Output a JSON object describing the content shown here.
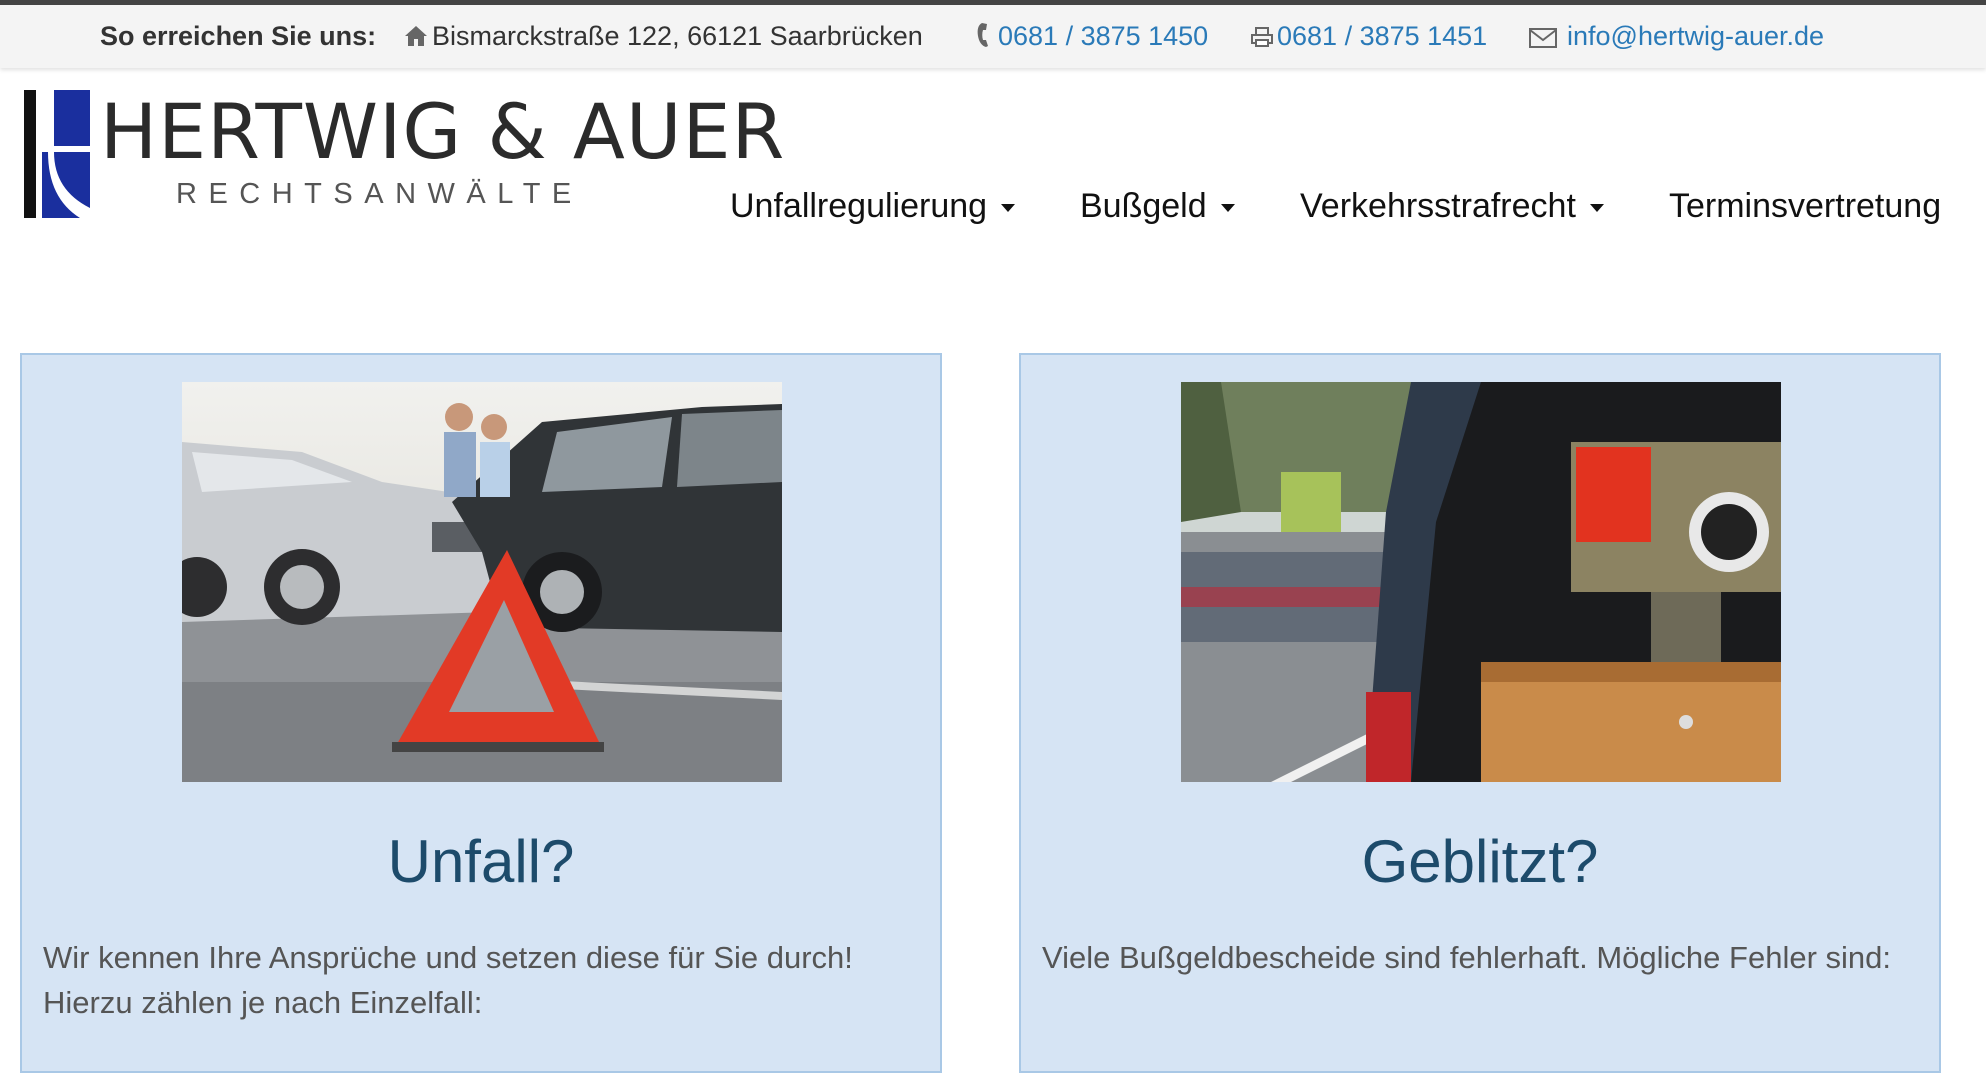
{
  "topbar": {
    "label": "So erreichen Sie uns:",
    "address": "Bismarckstraße 122, 66121 Saarbrücken",
    "phone": "0681 / 3875 1450",
    "fax": "0681 / 3875 1451",
    "email": "info@hertwig-auer.de",
    "icons": {
      "address": "home-icon",
      "phone": "phone-icon",
      "fax": "fax-icon",
      "email": "envelope-icon"
    },
    "link_color": "#2a7ab8"
  },
  "logo": {
    "title": "HERTWIG & AUER",
    "subtitle": "RECHTSANWÄLTE",
    "brand_color": "#1a2f9e"
  },
  "nav": {
    "items": [
      {
        "label": "Unfallregulierung",
        "has_dropdown": true
      },
      {
        "label": "Bußgeld",
        "has_dropdown": true
      },
      {
        "label": "Verkehrsstrafrecht",
        "has_dropdown": true
      },
      {
        "label": "Terminsvertretung",
        "has_dropdown": false
      }
    ]
  },
  "cards": [
    {
      "title": "Unfall?",
      "text": "Wir kennen Ihre Ansprüche und setzen diese für Sie durch! Hierzu zählen je nach Einzelfall:",
      "image": "car-accident-warning-triangle-photo"
    },
    {
      "title": "Geblitzt?",
      "text": "Viele Bußgeldbescheide sind fehlerhaft. Mögliche Fehler sind:",
      "image": "speed-camera-van-photo"
    }
  ],
  "colors": {
    "card_bg": "#d6e4f4",
    "card_border": "#a9c8e6",
    "card_title": "#1d4b6b"
  }
}
